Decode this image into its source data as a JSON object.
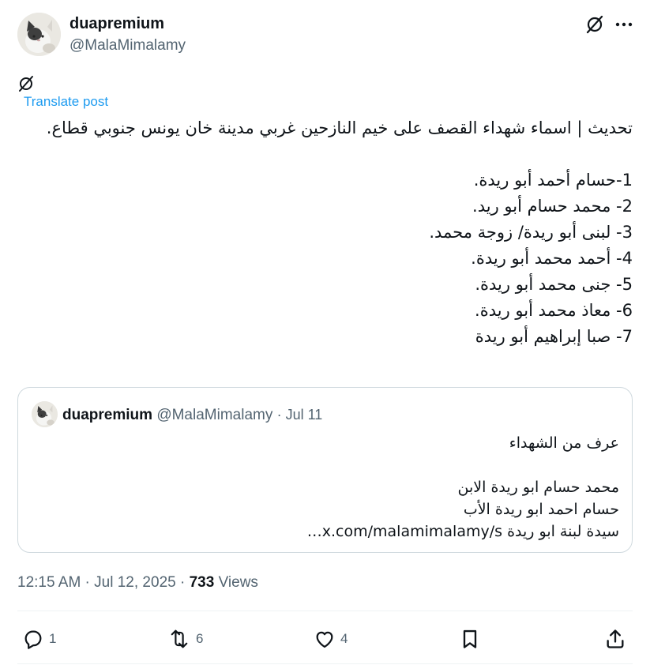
{
  "author": {
    "name": "duapremium",
    "handle": "@MalaMimalamy"
  },
  "icons": {
    "grok": "grok-icon",
    "more": "more-icon",
    "translate": "translate-icon",
    "reply": "reply-icon",
    "repost": "repost-icon",
    "like": "like-icon",
    "bookmark": "bookmark-icon",
    "share": "share-icon"
  },
  "translate_label": "Translate post",
  "post": {
    "headline": "تحديث | اسماء شهداء القصف على خيم النازحين غربي مدينة خان يونس جنوبي قطاع.",
    "names": [
      "1-حسام أحمد أبو ريدة.",
      "2- محمد حسام أبو ريد.",
      "3- لبنى أبو ريدة/ زوجة محمد.",
      "4- أحمد محمد أبو ريدة.",
      "5- جنى محمد أبو ريدة.",
      "6- معاذ محمد أبو ريدة.",
      "7- صبا إبراهيم أبو ريدة"
    ]
  },
  "quote": {
    "name": "duapremium",
    "handle": "@MalaMimalamy",
    "date": "· Jul 11",
    "lines": [
      "عرف من الشهداء",
      "محمد حسام ابو ريدة الابن",
      "حسام احمد ابو ريدة الأب",
      "سيدة لبنة ابو ريدة x.com/malamimalamy/s…"
    ]
  },
  "meta": {
    "time": "12:15 AM",
    "sep1": " · ",
    "date": "Jul 12, 2025",
    "sep2": " · ",
    "views_count": "733",
    "views_label": " Views"
  },
  "actions": {
    "replies": "1",
    "reposts": "6",
    "likes": "4"
  },
  "colors": {
    "text": "#0f1419",
    "secondary": "#536471",
    "link": "#1d9bf0",
    "border": "#cfd9de"
  }
}
